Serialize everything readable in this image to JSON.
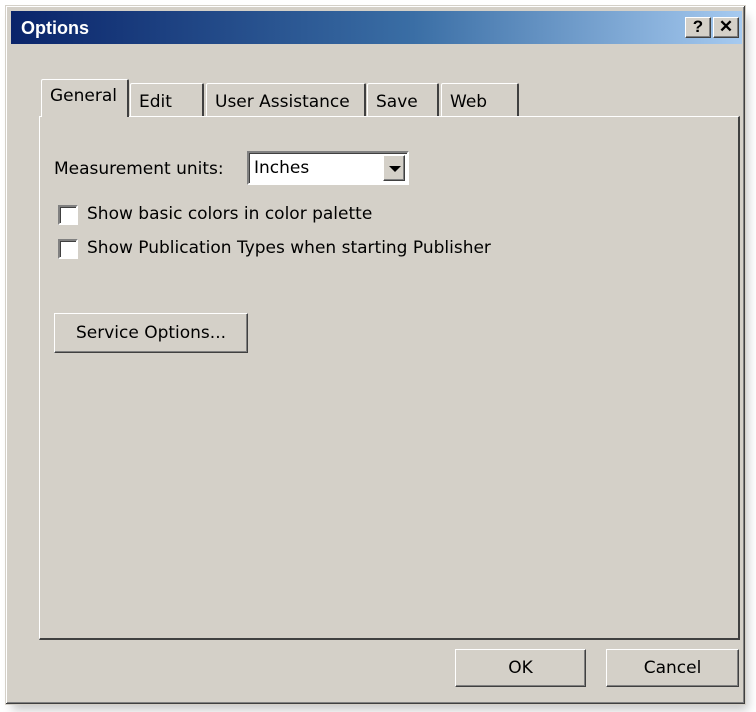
{
  "window": {
    "title": "Options",
    "help_glyph": "?",
    "close_glyph": "✕"
  },
  "tabs": [
    {
      "label": "General",
      "active": true
    },
    {
      "label": "Edit",
      "active": false
    },
    {
      "label": "User Assistance",
      "active": false
    },
    {
      "label": "Save",
      "active": false
    },
    {
      "label": "Web",
      "active": false
    }
  ],
  "general": {
    "measurement_label": "Measurement units:",
    "measurement_value": "Inches",
    "checkboxes": [
      {
        "label": "Show basic colors in color palette",
        "checked": false
      },
      {
        "label": "Show Publication Types when starting Publisher",
        "checked": false
      }
    ],
    "service_options_label": "Service Options..."
  },
  "footer": {
    "ok_label": "OK",
    "cancel_label": "Cancel"
  },
  "colors": {
    "face": "#d4d0c8",
    "title_start": "#0a246a",
    "title_end": "#a6caf0"
  }
}
